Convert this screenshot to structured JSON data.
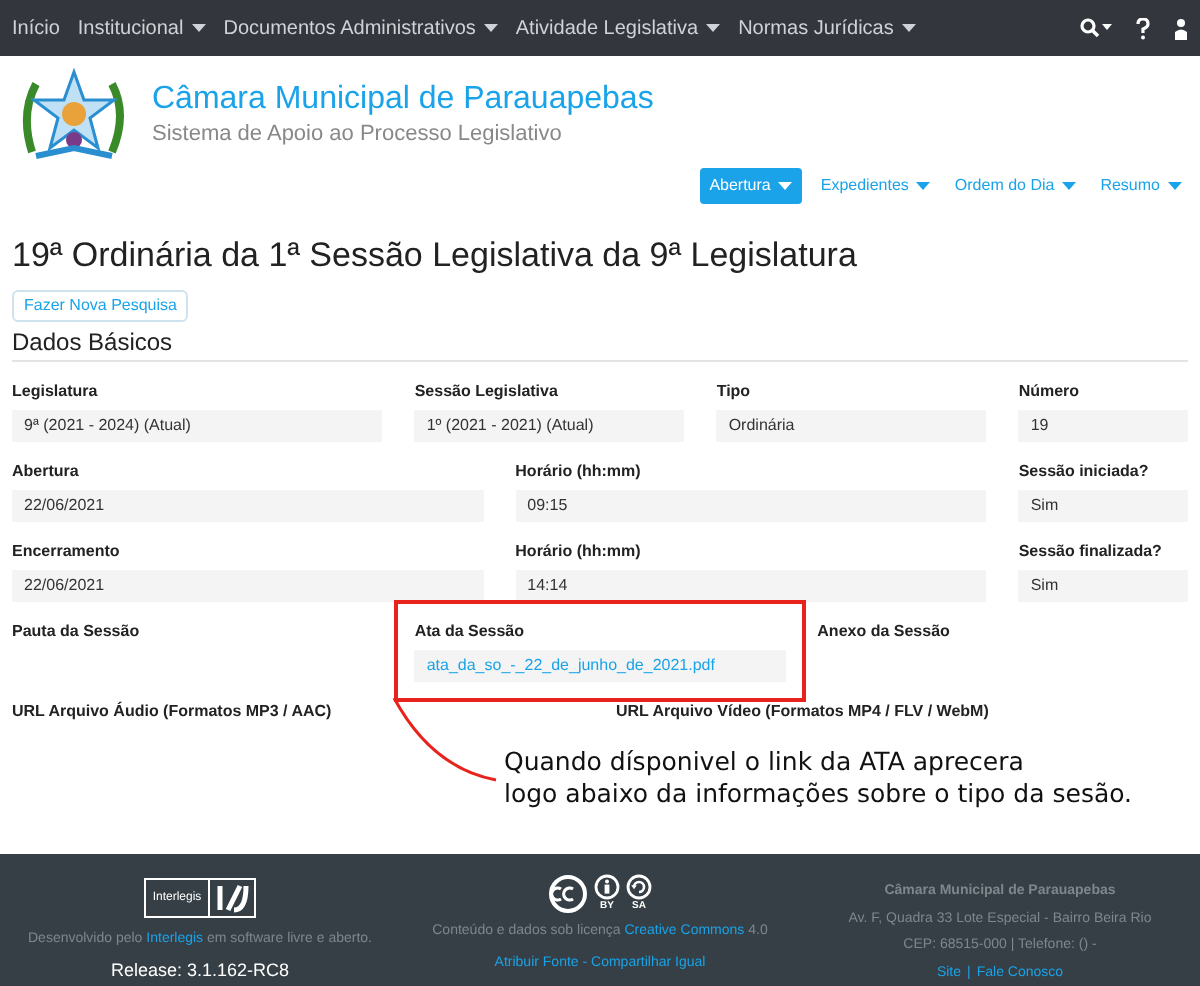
{
  "navbar": {
    "items": [
      {
        "label": "Início",
        "dropdown": false
      },
      {
        "label": "Institucional",
        "dropdown": true
      },
      {
        "label": "Documentos Administrativos",
        "dropdown": true
      },
      {
        "label": "Atividade Legislativa",
        "dropdown": true
      },
      {
        "label": "Normas Jurídicas",
        "dropdown": true
      }
    ]
  },
  "header": {
    "title": "Câmara Municipal de Parauapebas",
    "subtitle": "Sistema de Apoio ao Processo Legislativo"
  },
  "session_tabs": [
    {
      "label": "Abertura",
      "selected": true
    },
    {
      "label": "Expedientes",
      "selected": false
    },
    {
      "label": "Ordem do Dia",
      "selected": false
    },
    {
      "label": "Resumo",
      "selected": false
    }
  ],
  "page_title": "19ª Ordinária da 1ª Sessão Legislativa da 9ª Legislatura",
  "search_button": "Fazer Nova Pesquisa",
  "section_title": "Dados Básicos",
  "field_rows": [
    [
      {
        "label": "Legislatura",
        "value": "9ª (2021 - 2024) (Atual)",
        "kind": "text"
      },
      {
        "label": "Sessão Legislativa",
        "value": "1º (2021 - 2021) (Atual)",
        "kind": "text"
      },
      {
        "label": "Tipo",
        "value": "Ordinária",
        "kind": "text"
      },
      {
        "label": "Número",
        "value": "19",
        "kind": "text"
      }
    ],
    [
      {
        "label": "Abertura",
        "value": "22/06/2021",
        "kind": "text"
      },
      {
        "label": "Horário (hh:mm)",
        "value": "09:15",
        "kind": "text"
      },
      {
        "label": "Sessão iniciada?",
        "value": "Sim",
        "kind": "text"
      }
    ],
    [
      {
        "label": "Encerramento",
        "value": "22/06/2021",
        "kind": "text"
      },
      {
        "label": "Horário (hh:mm)",
        "value": "14:14",
        "kind": "text"
      },
      {
        "label": "Sessão finalizada?",
        "value": "Sim",
        "kind": "text"
      }
    ],
    [
      {
        "label": "Pauta da Sessão",
        "kind": "empty"
      },
      {
        "label": "Ata da Sessão",
        "value": "ata_da_so_-_22_de_junho_de_2021.pdf",
        "kind": "link",
        "highlighted": true
      },
      {
        "label": "Anexo da Sessão",
        "kind": "empty"
      }
    ],
    [
      {
        "label": "URL Arquivo Áudio (Formatos MP3 / AAC)",
        "kind": "empty"
      },
      {
        "label": "URL Arquivo Vídeo (Formatos MP4 / FLV / WebM)",
        "kind": "empty"
      }
    ]
  ],
  "annotation": {
    "lines": [
      "Quando dísponivel o link da ATA aprecera",
      "logo abaixo da informações sobre o tipo da sesão."
    ]
  },
  "footer": {
    "left": {
      "logo_text": "Interlegis",
      "before": "Desenvolvido pelo",
      "link": "Interlegis",
      "after": "em software livre e aberto.",
      "release": "Release: 3.1.162-RC8"
    },
    "center": {
      "badges": [
        "BY",
        "SA"
      ],
      "before": "Conteúdo e dados sob licença",
      "link": "Creative Commons",
      "after": "4.0",
      "license_link": "Atribuir Fonte - Compartilhar Igual"
    },
    "right": {
      "name": "Câmara Municipal de Parauapebas",
      "address": "Av. F, Quadra 33 Lote Especial - Bairro Beira Rio",
      "contact": "CEP: 68515-000 | Telefone: () -",
      "links": [
        "Site",
        "Fale Conosco"
      ],
      "separator": "|"
    }
  }
}
